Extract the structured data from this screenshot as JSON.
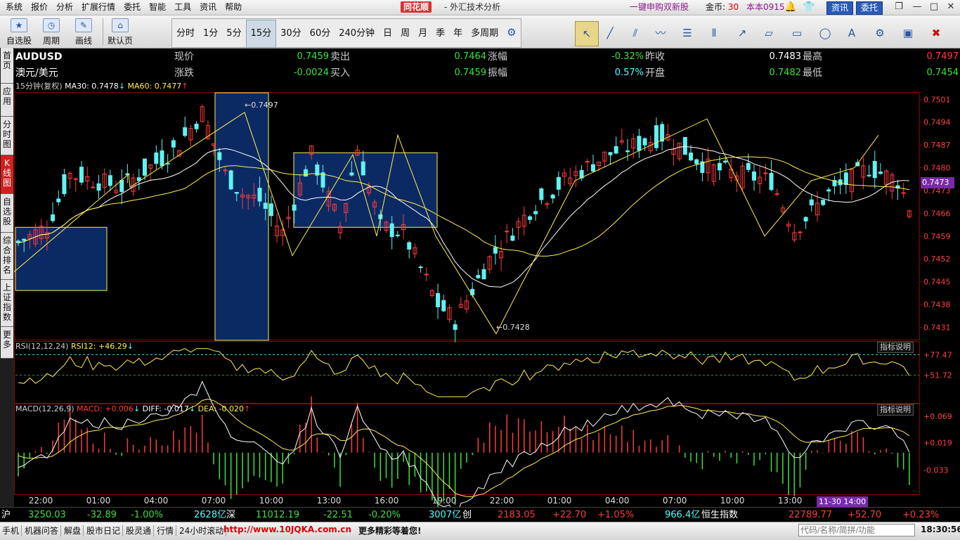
{
  "menu": {
    "items": [
      "系统",
      "报价",
      "分析",
      "扩展行情",
      "委托",
      "智能",
      "工具",
      "资讯",
      "帮助"
    ]
  },
  "brand": "同花顺",
  "app_title": "- 外汇技术分析",
  "promo": "一键申购双新股",
  "coins_label": "金币:",
  "coins_value": "30",
  "version": "本本0915",
  "btn_news": "资讯",
  "btn_trade": "委托",
  "toolbar": {
    "fav_label": "自选股",
    "period_label": "周期",
    "draw_label": "画线",
    "home_label": "默认页",
    "periods": [
      "分时",
      "1分",
      "5分",
      "15分",
      "30分",
      "60分",
      "240分钟",
      "日",
      "周",
      "月",
      "季",
      "年",
      "多周期"
    ],
    "active_period": "15分"
  },
  "left_tabs": [
    "首页",
    "应用",
    "分时图",
    "K线图",
    "自选股",
    "综合排名",
    "上证指数",
    "更多"
  ],
  "quote": {
    "symbol": "AUDUSD",
    "name": "澳元/美元",
    "labels": {
      "now": "现价",
      "sell": "卖出",
      "chg_pct": "涨幅",
      "prev_close": "昨收",
      "high": "最高",
      "change": "涨跌",
      "buy": "买入",
      "amplitude": "振幅",
      "open": "开盘",
      "low": "最低"
    },
    "now": "0.7459",
    "sell": "0.7464",
    "chg_pct": "-0.32%",
    "prev_close": "0.7483",
    "high": "0.7497",
    "change": "-0.0024",
    "buy": "0.7459",
    "amplitude": "0.57%",
    "open": "0.7482",
    "low": "0.7454"
  },
  "ma_legend": {
    "period": "15分钟(复权)",
    "ma30": "MA30: 0.7478",
    "ma60": "MA60: 0.7477"
  },
  "rsi_legend": {
    "title": "RSI(12,12,24)",
    "rsi12": "RSI12: +46.29"
  },
  "macd_legend": {
    "title": "MACD(12,26,9)",
    "macd": "MACD: +0.006",
    "diff": "DIFF: -0.017",
    "dea": "DEA: -0.020"
  },
  "indicator_help": "指标说明",
  "annotations": {
    "high_mark": "0.7497",
    "low_mark": "0.7428"
  },
  "cursor_price": "0.7473",
  "cursor_time": "11-30 14:00",
  "colors": {
    "up": "#ff3b3b",
    "down": "#5ff3f3",
    "ma30": "#ffffff",
    "ma60": "#ffef4f",
    "box": "#0b2a63"
  },
  "chart_data": {
    "type": "candlestick",
    "title": "",
    "price_axis": [
      "0.7501",
      "0.7494",
      "0.7487",
      "0.7480",
      "0.7473",
      "0.7466",
      "0.7459",
      "0.7452",
      "0.7445",
      "0.7438",
      "0.7431"
    ],
    "ylim": [
      0.7427,
      0.7503
    ],
    "time_axis": [
      "22:00",
      "01:00",
      "04:00",
      "07:00",
      "10:00",
      "13:00",
      "16:00",
      "19:00",
      "22:00",
      "01:00",
      "04:00",
      "07:00",
      "10:00",
      "13:00",
      "16:00"
    ],
    "rsi_axis": [
      "+77.47",
      "+51.72"
    ],
    "macd_axis": [
      "+0.069",
      "+0.019",
      "-0.033"
    ],
    "grid": false
  },
  "statusbar": {
    "sh_label": "沪",
    "sh_index": "3250.03",
    "sh_change": "-32.89",
    "sh_pct": "-1.00%",
    "sh_vol": "2628亿",
    "sz_label": "深",
    "sz_index": "11012.19",
    "sz_change": "-22.51",
    "sz_pct": "-0.20%",
    "sz_vol": "3007亿",
    "cy_label": "创",
    "cy_index": "2183.05",
    "cy_change": "+22.70",
    "cy_pct": "+1.05%",
    "cy_vol": "966.4亿",
    "hs_label": "恒生指数",
    "hs_index": "22789.77",
    "hs_change": "+52.70",
    "hs_pct": "+0.23%"
  },
  "bottombar": {
    "items": [
      "手机",
      "机器问答",
      "解盘",
      "股市日记",
      "股灵通",
      "行情",
      "24小时滚动"
    ],
    "url": "http://www.10JQKA.com.cn",
    "more": "更多精彩等着您!",
    "search_placeholder": "代码/名称/简拼/功能",
    "clock": "18:30:56"
  }
}
